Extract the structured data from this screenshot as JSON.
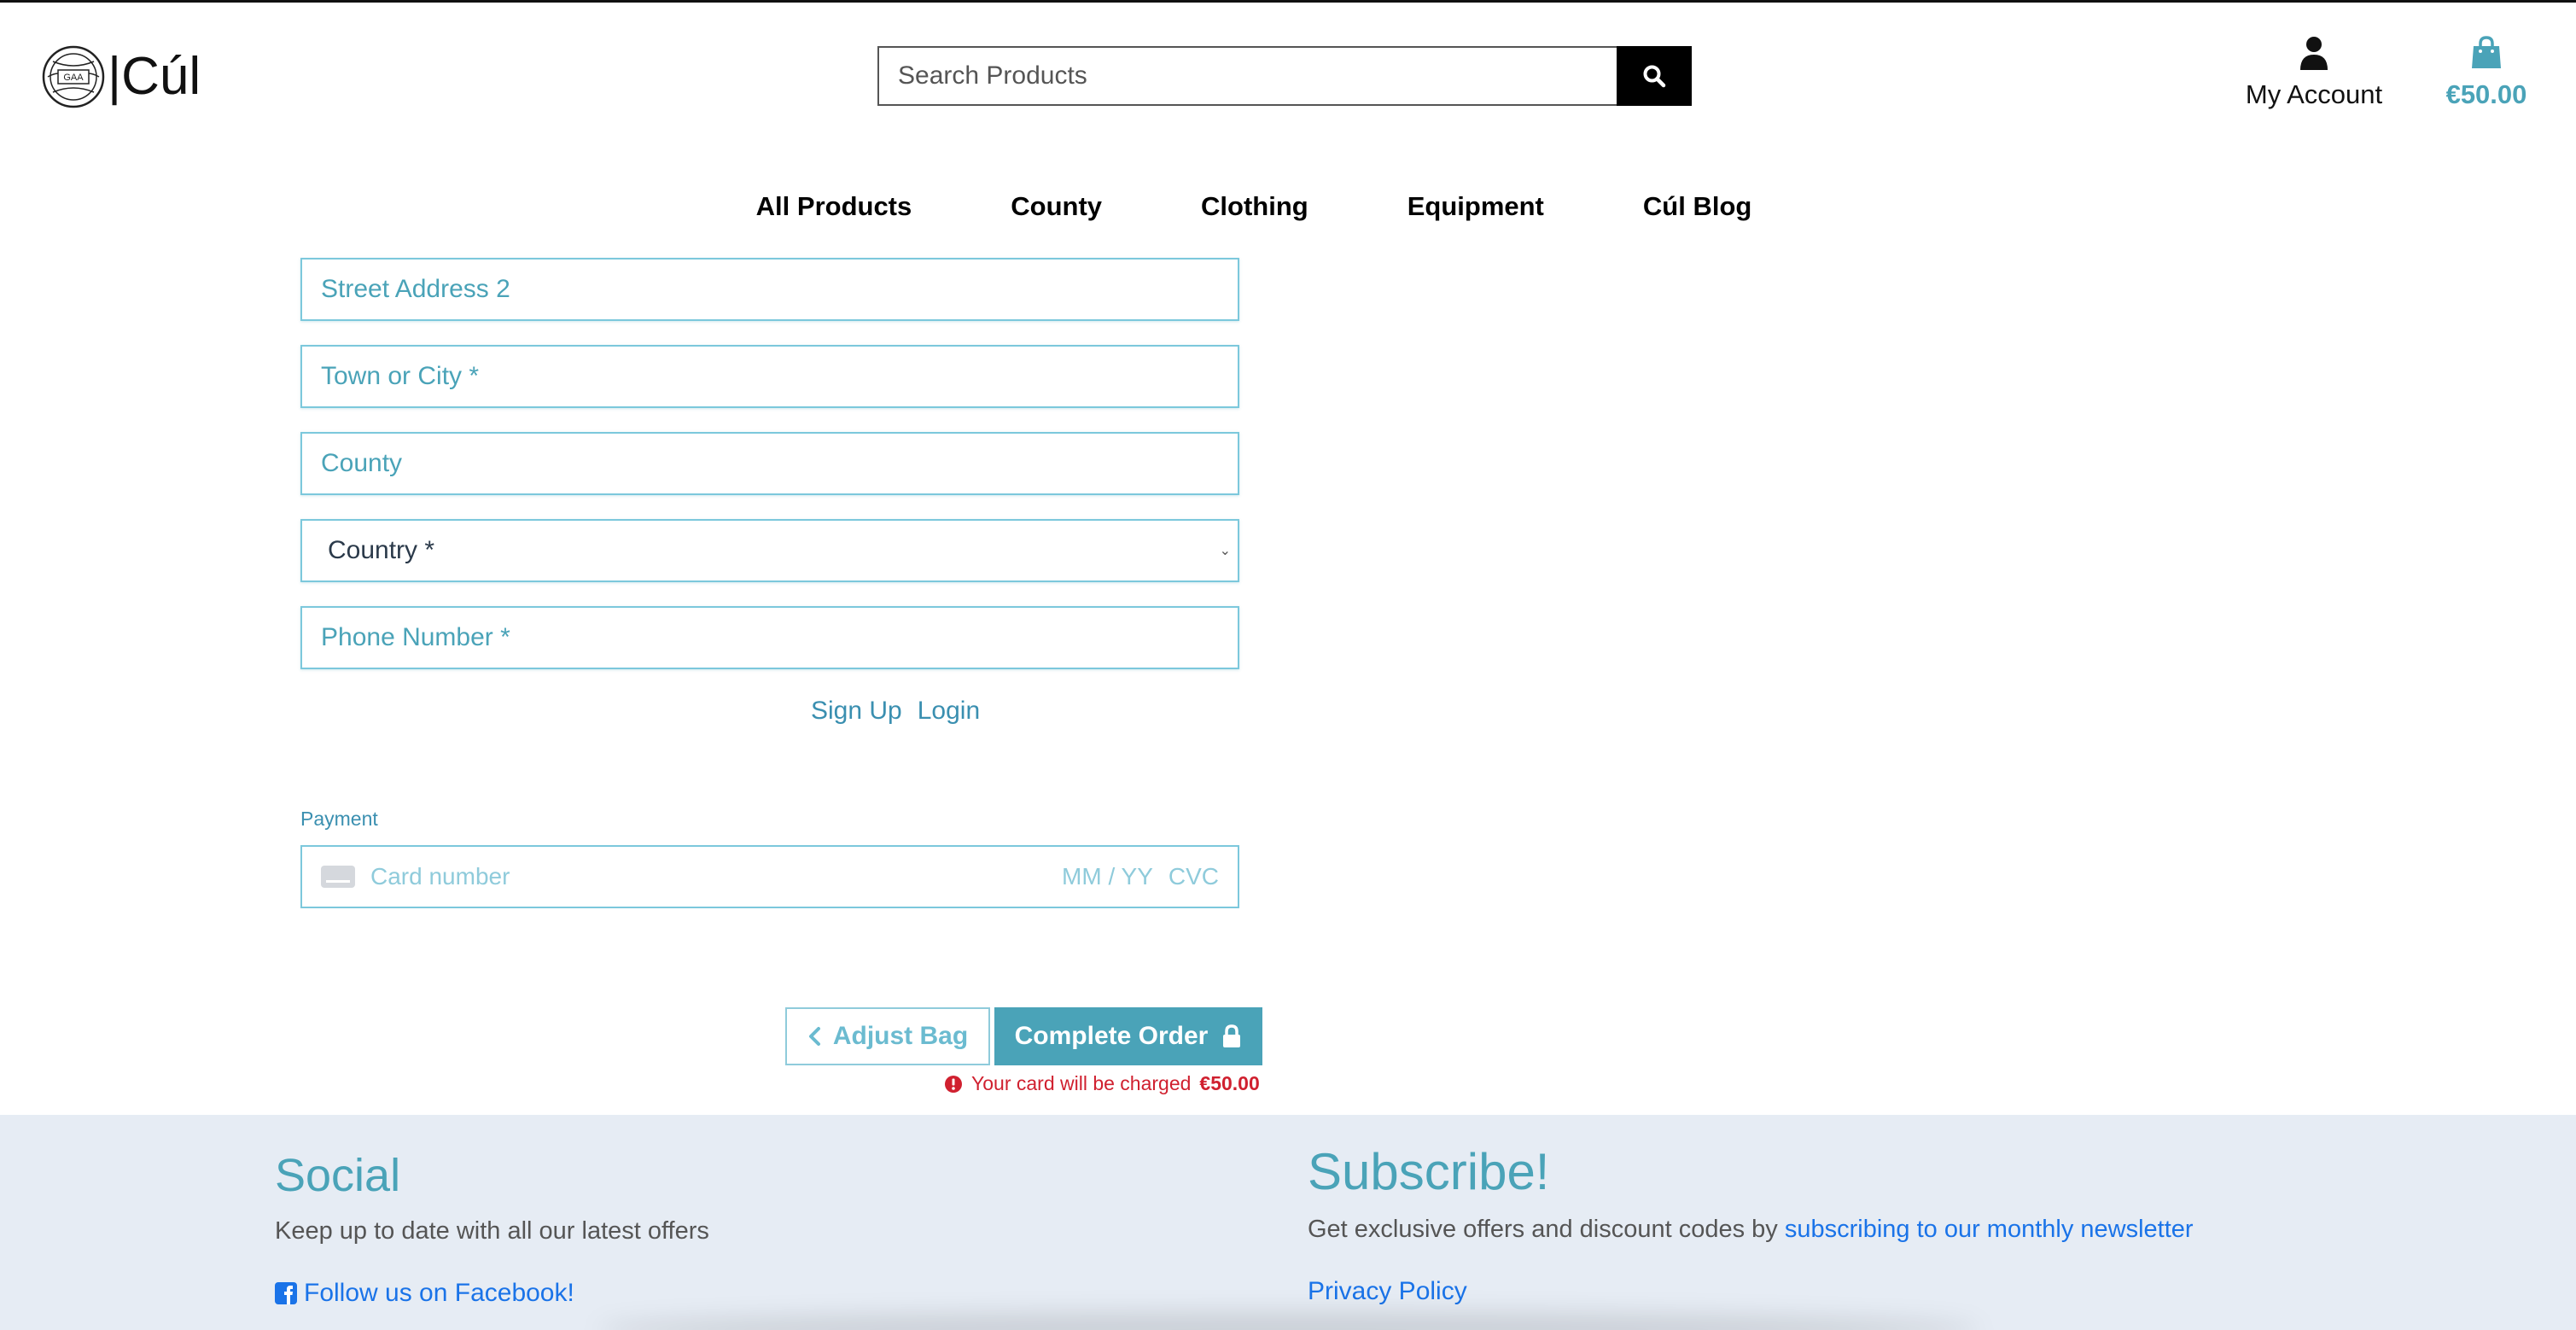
{
  "header": {
    "logo_text": "|Cúl",
    "logo_mark_text": "GAA",
    "search_placeholder": "Search Products",
    "account_label": "My Account",
    "bag_total": "€50.00"
  },
  "nav": {
    "items": [
      "All Products",
      "County",
      "Clothing",
      "Equipment",
      "Cúl Blog"
    ]
  },
  "form": {
    "street_address_2": "Street Address 2",
    "town_or_city": "Town or City *",
    "county": "County",
    "country": "Country *",
    "phone_number": "Phone Number *",
    "sign_up": "Sign Up",
    "login": "Login"
  },
  "payment": {
    "label": "Payment",
    "card_number": "Card number",
    "expiry": "MM / YY",
    "cvc": "CVC"
  },
  "actions": {
    "adjust_bag": "Adjust Bag",
    "complete_order": "Complete Order",
    "charge_note_prefix": "Your card will be charged",
    "charge_amount": "€50.00"
  },
  "footer": {
    "social_title": "Social",
    "social_text": "Keep up to date with all our latest offers",
    "facebook_link": "Follow us on Facebook!",
    "subscribe_title": "Subscribe!",
    "subscribe_text": "Get exclusive offers and discount codes by",
    "subscribe_link": "subscribing to our monthly newsletter",
    "privacy_link": "Privacy Policy"
  },
  "colors": {
    "accent": "#4aa3b8",
    "link": "#1a73e8",
    "error": "#d0202f",
    "footer_bg": "#e6ecf4"
  },
  "icons": [
    "gaa-ball-logo",
    "search-icon",
    "user-icon",
    "shopping-bag-icon",
    "chevron-down-icon",
    "credit-card-icon",
    "chevron-left-icon",
    "lock-icon",
    "exclamation-circle-icon",
    "facebook-icon"
  ]
}
